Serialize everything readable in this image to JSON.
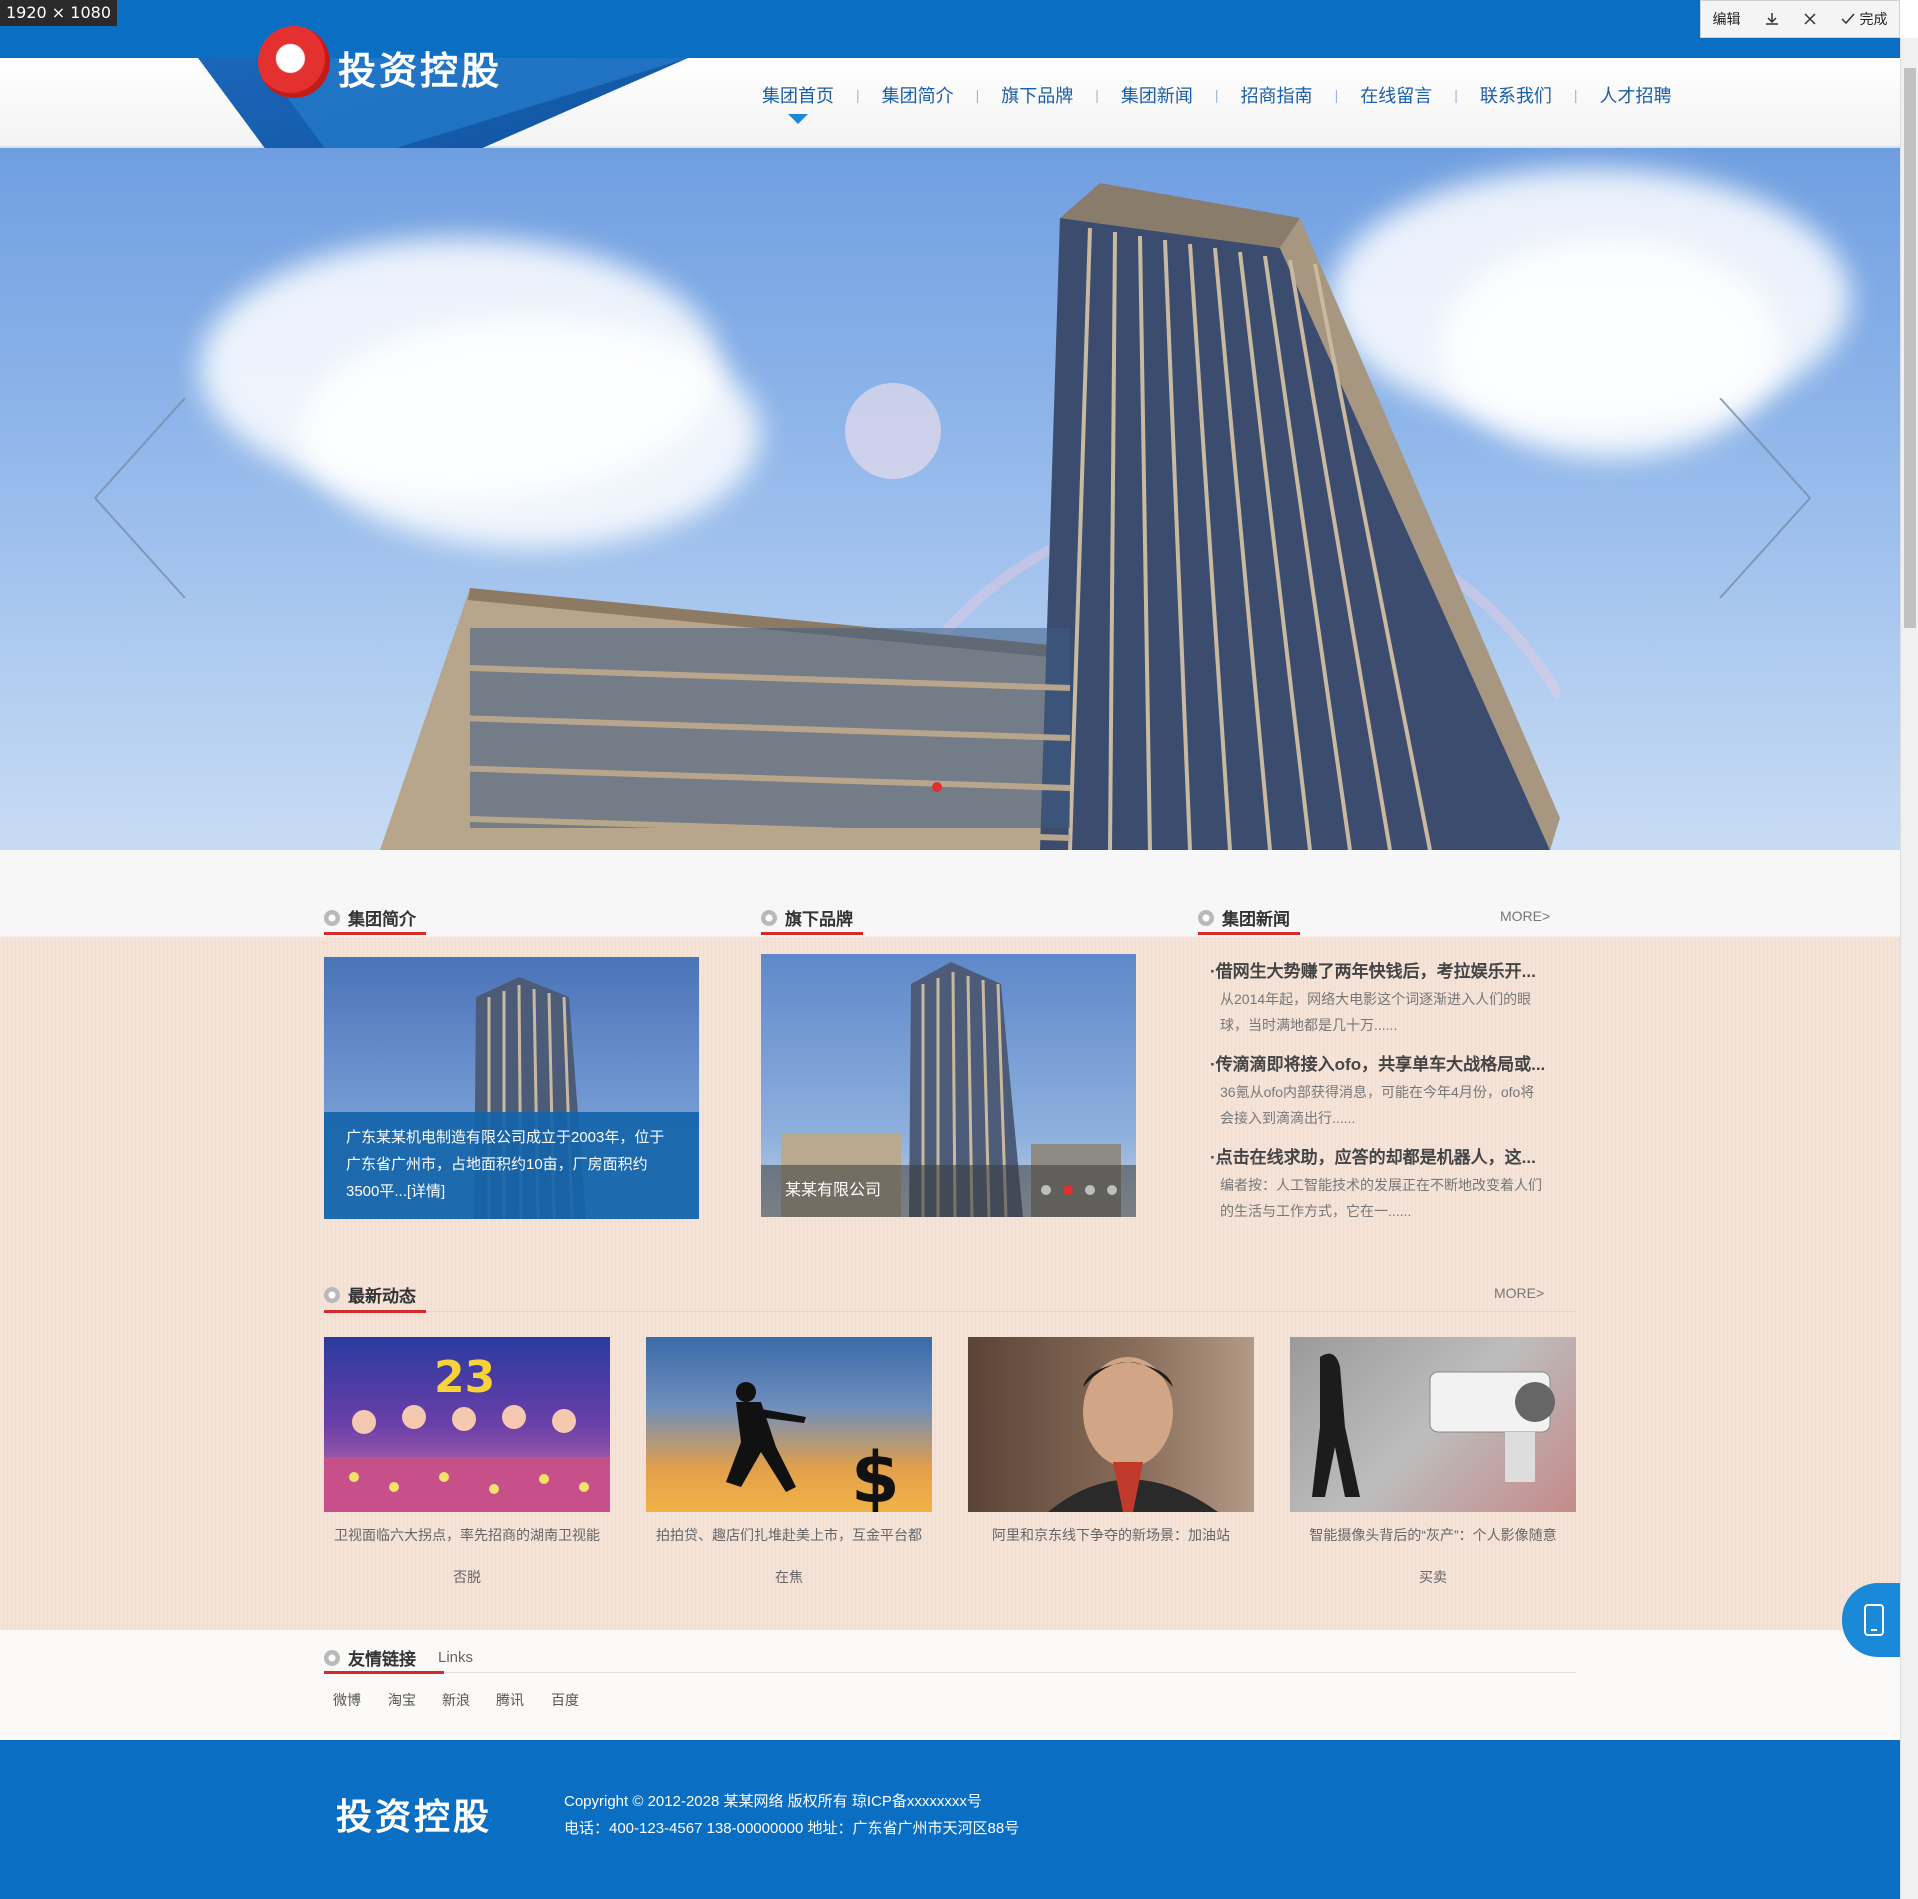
{
  "capture": {
    "size_label": "1920 × 1080",
    "edit_label": "编辑",
    "done_label": "完成"
  },
  "site": {
    "logo_text": "投资控股"
  },
  "nav": {
    "items": [
      "集团首页",
      "集团简介",
      "旗下品牌",
      "集团新闻",
      "招商指南",
      "在线留言",
      "联系我们",
      "人才招聘"
    ],
    "active_index": 0
  },
  "banner": {
    "slide_dots": 1
  },
  "intro": {
    "title": "集团简介",
    "text_lines": [
      "广东某某机电制造有限公司成立于2003年，位于",
      "广东省广州市，占地面积约10亩，厂房面积约",
      "3500平...[详情]"
    ]
  },
  "brands": {
    "title": "旗下品牌",
    "caption": "某某有限公司",
    "dots": 4,
    "active_dot": 1
  },
  "news": {
    "title": "集团新闻",
    "more": "MORE>",
    "items": [
      {
        "title": "·借网生大势赚了两年快钱后，考拉娱乐开...",
        "summary_lines": [
          "从2014年起，网络大电影这个词逐渐进入人们的眼",
          "球，当时满地都是几十万......"
        ]
      },
      {
        "title": "·传滴滴即将接入ofo，共享单车大战格局或...",
        "summary_lines": [
          "36氪从ofo内部获得消息，可能在今年4月份，ofo将",
          "会接入到滴滴出行......"
        ]
      },
      {
        "title": "·点击在线求助，应答的却都是机器人，这...",
        "summary_lines": [
          "编者按：人工智能技术的发展正在不断地改变着人们",
          "的生活与工作方式，它在一......"
        ]
      }
    ]
  },
  "dynamics": {
    "title": "最新动态",
    "more": "MORE>",
    "items": [
      {
        "line1": "卫视面临六大拐点，率先招商的湖南卫视能",
        "line2": "否脱"
      },
      {
        "line1": "拍拍贷、趣店们扎堆赴美上市，互金平台都",
        "line2": "在焦"
      },
      {
        "line1": "阿里和京东线下争夺的新场景：加油站",
        "line2": ""
      },
      {
        "line1": "智能摄像头背后的“灰产”：个人影像随意",
        "line2": "买卖"
      }
    ]
  },
  "links": {
    "title": "友情链接",
    "subtitle": "Links",
    "items": [
      "微博",
      "淘宝",
      "新浪",
      "腾讯",
      "百度"
    ]
  },
  "footer": {
    "logo_text": "投资控股",
    "copyright": "Copyright © 2012-2028 某某网络 版权所有  琼ICP备xxxxxxxx号",
    "contact": "电话：400-123-4567   138-00000000   地址：广东省广州市天河区88号"
  },
  "colors": {
    "brand_blue": "#0a6ec2",
    "accent_red": "#d42a2a",
    "content_bg": "#f5e3d8"
  }
}
